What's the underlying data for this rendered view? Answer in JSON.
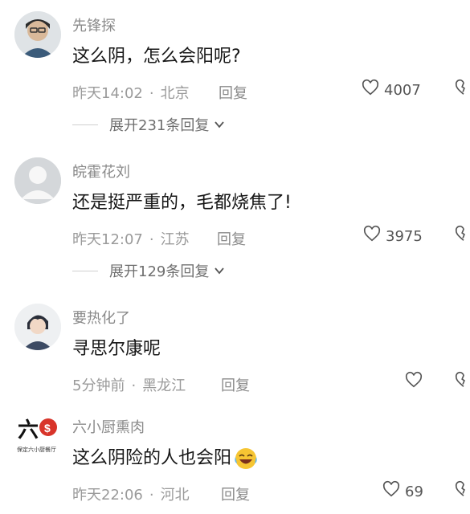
{
  "comments": [
    {
      "user": "先锋探",
      "text": "这么阴，怎么会阳呢?",
      "time": "昨天14:02",
      "sep": "·",
      "location": "北京",
      "reply_label": "回复",
      "likes": "4007",
      "expand": "展开231条回复"
    },
    {
      "user": "皖霍花刘",
      "text": "还是挺严重的，毛都烧焦了!",
      "time": "昨天12:07",
      "sep": "·",
      "location": "江苏",
      "reply_label": "回复",
      "likes": "3975",
      "expand": "展开129条回复"
    },
    {
      "user": "要热化了",
      "text": "寻思尔康呢",
      "time": "5分钟前",
      "sep": "·",
      "location": "黑龙江",
      "reply_label": "回复",
      "likes": ""
    },
    {
      "user": "六小厨熏肉",
      "text": "这么阴险的人也会阳",
      "time": "昨天22:06",
      "sep": "·",
      "location": "河北",
      "reply_label": "回复",
      "likes": "69",
      "avatar_logo": "六",
      "avatar_sub": "保定六小厨餐厅"
    }
  ],
  "icons": {
    "like": "heart-outline-icon",
    "dislike": "broken-heart-icon",
    "expand": "chevron-down-icon",
    "emoji": "laughing-tears-emoji-icon"
  }
}
